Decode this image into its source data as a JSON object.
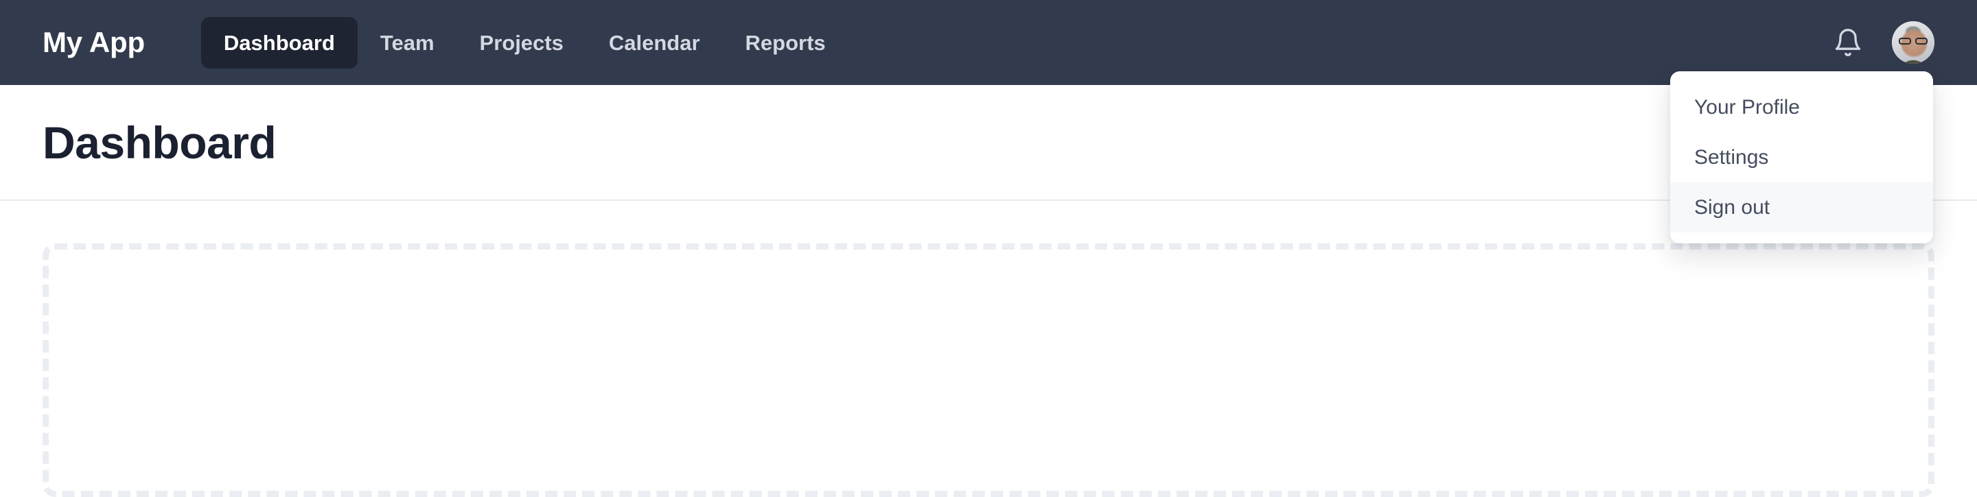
{
  "navbar": {
    "brand": "My App",
    "links": [
      {
        "label": "Dashboard",
        "active": true
      },
      {
        "label": "Team",
        "active": false
      },
      {
        "label": "Projects",
        "active": false
      },
      {
        "label": "Calendar",
        "active": false
      },
      {
        "label": "Reports",
        "active": false
      }
    ],
    "notifications_icon": "bell-icon",
    "avatar_alt": "user-avatar-photo",
    "background_color": "#323a4d",
    "active_pill_color": "#1e2432"
  },
  "header": {
    "title": "Dashboard"
  },
  "main": {
    "placeholder_style": "dashed-outline-box",
    "placeholder_border_color": "#eaedf2"
  },
  "profile_menu": {
    "open": true,
    "items": [
      {
        "label": "Your Profile",
        "hovered": false
      },
      {
        "label": "Settings",
        "hovered": false
      },
      {
        "label": "Sign out",
        "hovered": true
      }
    ],
    "hover_background": "#f7f8fa"
  }
}
